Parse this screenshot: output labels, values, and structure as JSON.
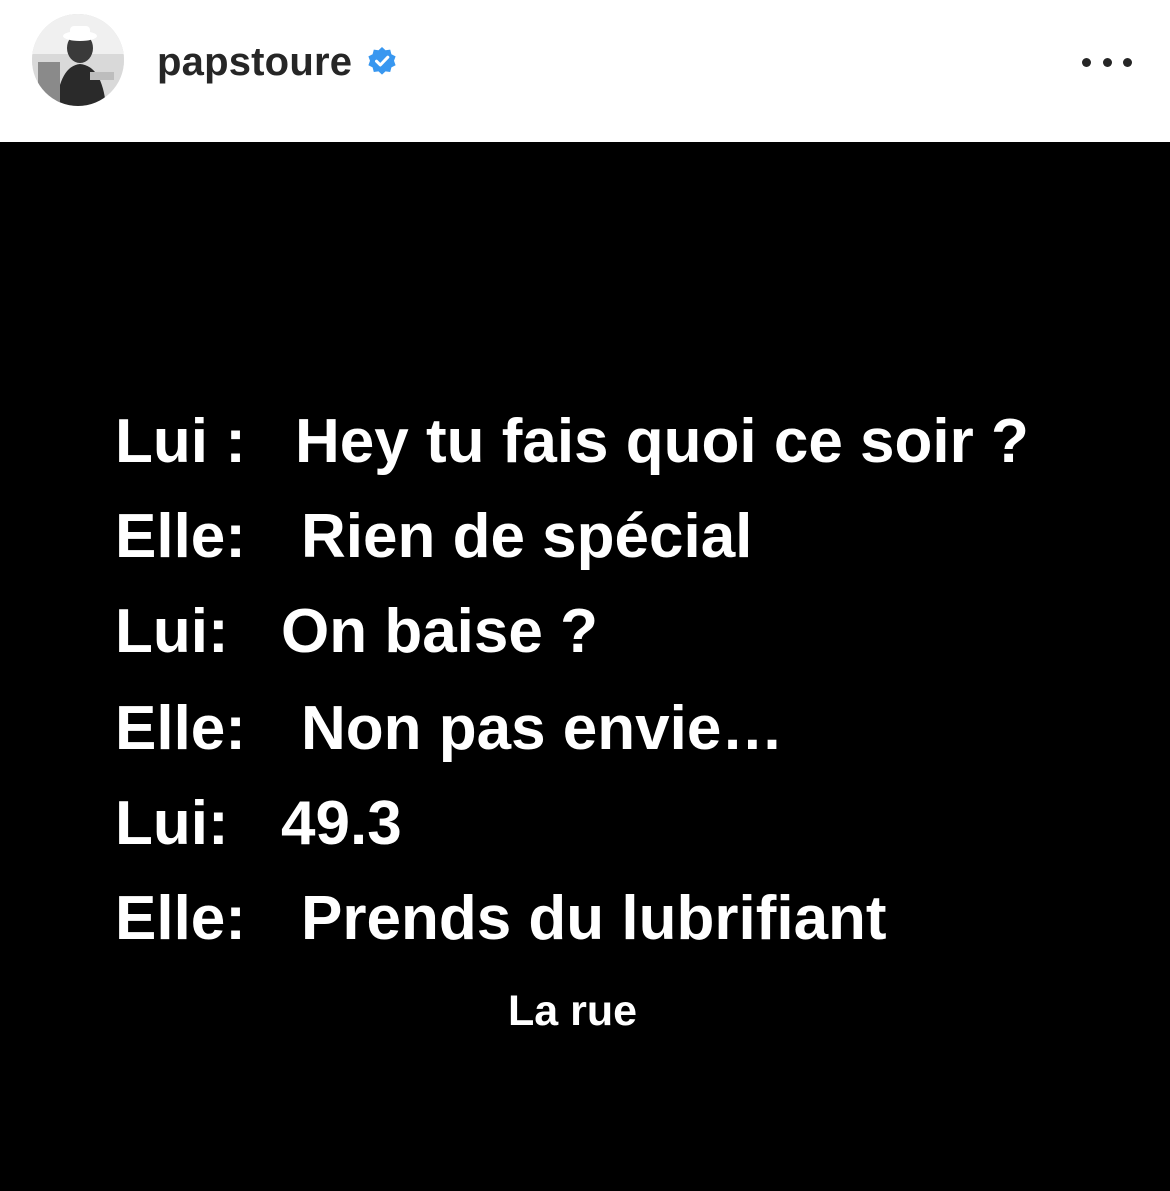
{
  "header": {
    "username": "papstoure",
    "verified_color": "#3897f0",
    "avatar_icon": "profile-photo-avatar",
    "more_icon": "more-horizontal-icon"
  },
  "post": {
    "background": "#000000",
    "lines": [
      {
        "speaker": "Lui :",
        "text": "Hey tu fais quoi ce soir ?"
      },
      {
        "speaker": "Elle:",
        "text": "Rien de spécial"
      },
      {
        "speaker": "Lui:",
        "text": "On baise ?"
      },
      {
        "speaker": "Elle:",
        "text": "Non pas envie…"
      },
      {
        "speaker": "Lui:",
        "text": "49.3"
      },
      {
        "speaker": "Elle:",
        "text": "Prends du lubrifiant"
      }
    ],
    "signature": "La rue"
  }
}
